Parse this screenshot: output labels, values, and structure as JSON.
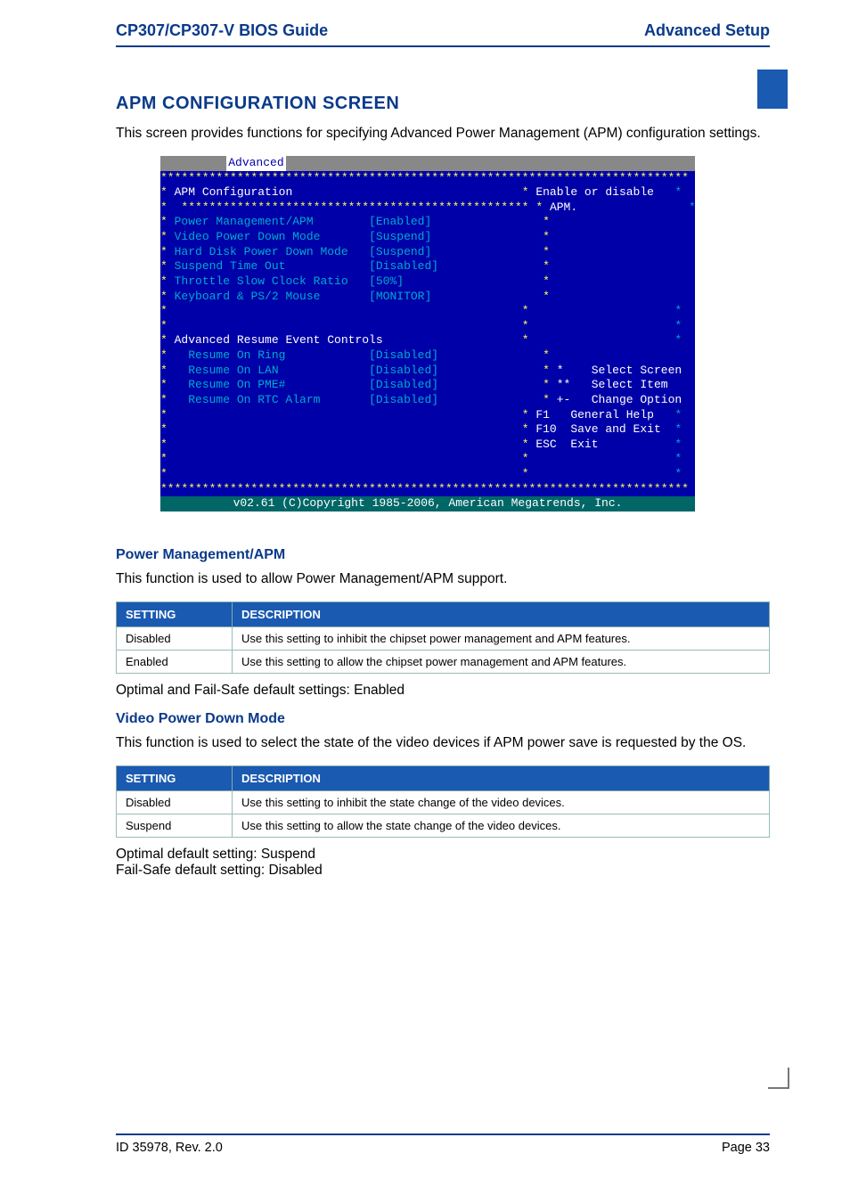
{
  "header": {
    "left": "CP307/CP307-V BIOS Guide",
    "right": "Advanced Setup"
  },
  "section_title": "APM CONFIGURATION SCREEN",
  "section_intro": "This screen provides functions for specifying Advanced Power Management (APM) configuration settings.",
  "bios": {
    "tab": "Advanced",
    "title": "APM Configuration",
    "help": "Enable or disable APM.",
    "items": [
      {
        "label": "Power Management/APM",
        "value": "[Enabled]"
      },
      {
        "label": "Video Power Down Mode",
        "value": "[Suspend]"
      },
      {
        "label": "Hard Disk Power Down Mode",
        "value": "[Suspend]"
      },
      {
        "label": "Suspend Time Out",
        "value": "[Disabled]"
      },
      {
        "label": "Throttle Slow Clock Ratio",
        "value": "[50%]"
      },
      {
        "label": "Keyboard & PS/2 Mouse",
        "value": "[MONITOR]"
      }
    ],
    "subhead": "Advanced Resume Event Controls",
    "resume": [
      {
        "label": "Resume On Ring",
        "value": "[Disabled]"
      },
      {
        "label": "Resume On LAN",
        "value": "[Disabled]"
      },
      {
        "label": "Resume On PME#",
        "value": "[Disabled]"
      },
      {
        "label": "Resume On RTC Alarm",
        "value": "[Disabled]"
      }
    ],
    "nav": [
      {
        "key": "*",
        "label": "Select Screen"
      },
      {
        "key": "**",
        "label": "Select Item"
      },
      {
        "key": "+-",
        "label": "Change Option"
      },
      {
        "key": "F1",
        "label": "General Help"
      },
      {
        "key": "F10",
        "label": "Save and Exit"
      },
      {
        "key": "ESC",
        "label": "Exit"
      }
    ],
    "footer": "v02.61 (C)Copyright 1985-2006, American Megatrends, Inc."
  },
  "pm": {
    "heading": "Power Management/APM",
    "intro": "This function is used to allow Power Management/APM support.",
    "col1": "SETTING",
    "col2": "DESCRIPTION",
    "rows": [
      {
        "s": "Disabled",
        "d": "Use this setting to inhibit the chipset power management and APM features."
      },
      {
        "s": "Enabled",
        "d": "Use this setting to allow the chipset power management and APM features."
      }
    ],
    "defaults": "Optimal and Fail-Safe default settings: Enabled"
  },
  "vpd": {
    "heading": "Video Power Down Mode",
    "intro": "This function is used to select the state of the video devices if APM power save is requested by the OS.",
    "col1": "SETTING",
    "col2": "DESCRIPTION",
    "rows": [
      {
        "s": "Disabled",
        "d": "Use this setting to inhibit the state change of the video devices."
      },
      {
        "s": "Suspend",
        "d": "Use this setting to allow the state change of the video devices."
      }
    ],
    "defaults1": "Optimal default setting:   Suspend",
    "defaults2": "Fail-Safe default setting: Disabled"
  },
  "footer": {
    "left": "ID 35978, Rev. 2.0",
    "right": "Page 33"
  }
}
